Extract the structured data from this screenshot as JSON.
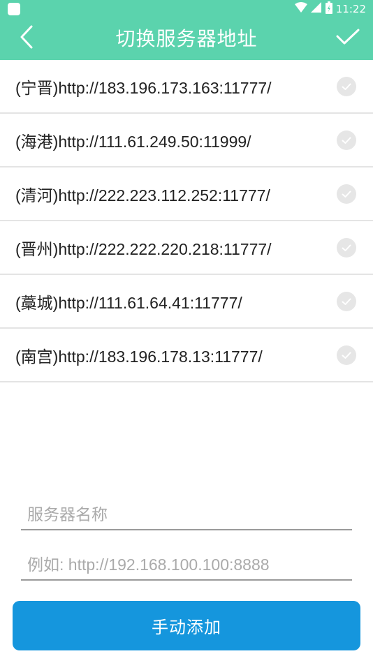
{
  "status_bar": {
    "time": "11:22",
    "icons": [
      "app-icon",
      "wifi-icon",
      "signal-icon",
      "battery-icon"
    ]
  },
  "header": {
    "title": "切换服务器地址",
    "back_icon": "chevron-left-icon",
    "confirm_icon": "checkmark-icon",
    "background_color": "#5bd3ad"
  },
  "servers": [
    {
      "label": "(宁晋)http://183.196.173.163:11777/",
      "selected": false
    },
    {
      "label": "(海港)http://111.61.249.50:11999/",
      "selected": false
    },
    {
      "label": "(清河)http://222.223.112.252:11777/",
      "selected": false
    },
    {
      "label": "(晋州)http://222.222.220.218:11777/",
      "selected": false
    },
    {
      "label": "(藁城)http://111.61.64.41:11777/",
      "selected": false
    },
    {
      "label": "(南宫)http://183.196.178.13:11777/",
      "selected": false
    }
  ],
  "form": {
    "name_placeholder": "服务器名称",
    "name_value": "",
    "url_placeholder": "例如: http://192.168.100.100:8888",
    "url_value": "",
    "add_button_label": "手动添加",
    "button_color": "#1596dd"
  }
}
